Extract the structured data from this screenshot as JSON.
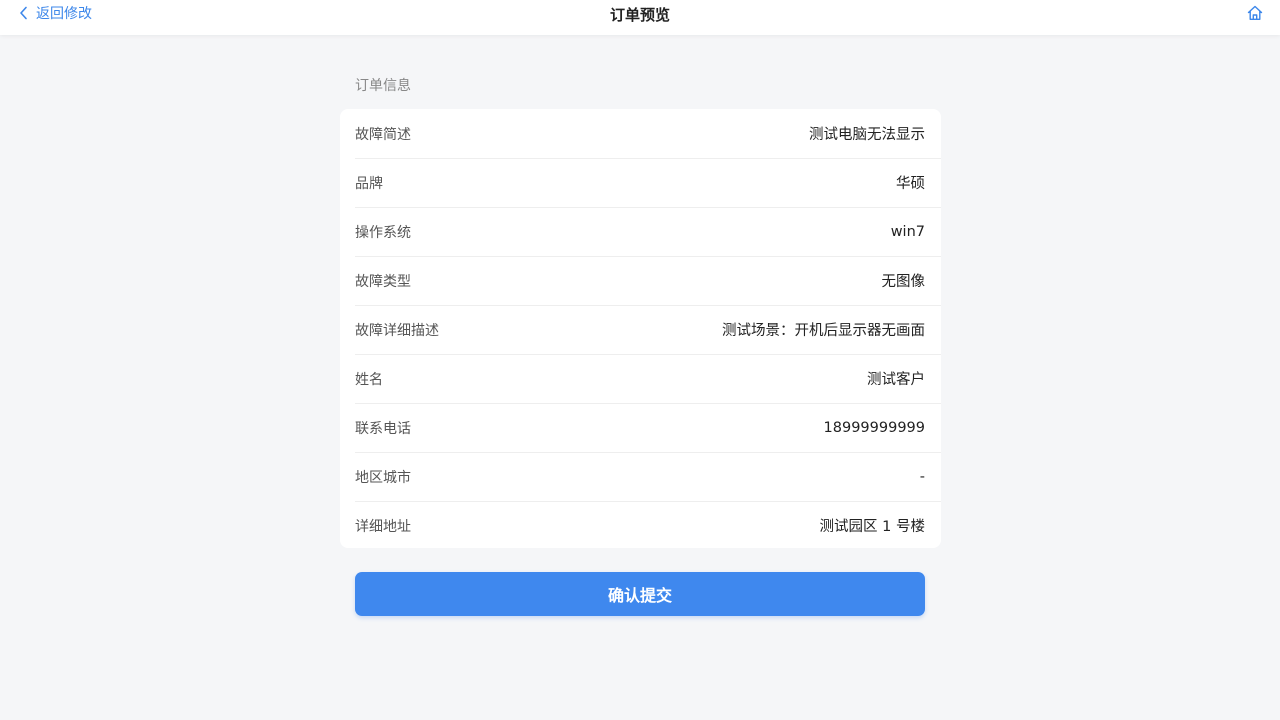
{
  "nav": {
    "back_label": "返回修改",
    "title": "订单预览",
    "home_icon": "home-icon",
    "accent": "#3d87ea"
  },
  "section": {
    "title": "订单信息"
  },
  "rows": [
    {
      "label": "故障简述",
      "value": "测试电脑无法显示"
    },
    {
      "label": "品牌",
      "value": "华硕"
    },
    {
      "label": "操作系统",
      "value": "win7"
    },
    {
      "label": "故障类型",
      "value": "无图像"
    },
    {
      "label": "故障详细描述",
      "value": "测试场景：开机后显示器无画面"
    },
    {
      "label": "姓名",
      "value": "测试客户"
    },
    {
      "label": "联系电话",
      "value": "18999999999"
    },
    {
      "label": "地区城市",
      "value": "-"
    },
    {
      "label": "详细地址",
      "value": "测试园区 1 号楼"
    }
  ],
  "submit": {
    "label": "确认提交",
    "color": "#3f88ee"
  }
}
